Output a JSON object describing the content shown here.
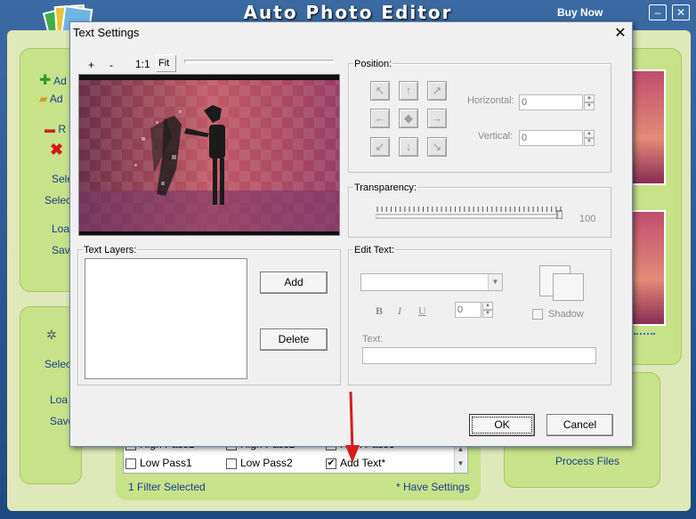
{
  "app": {
    "title": "Auto Photo Editor",
    "buy_now": "Buy Now",
    "minimize_glyph": "–",
    "close_glyph": "✕",
    "left_panel": {
      "items": [
        "Ad",
        "Ad",
        "R",
        "Sele",
        "Selec",
        "Loa",
        "Sav"
      ]
    },
    "left_panel2": {
      "items": [
        "Selec",
        "Loa",
        "Save"
      ]
    },
    "filters": {
      "row1": [
        "High Pass1",
        "High Pass2",
        "High Pass3"
      ],
      "row2": [
        "Low Pass1",
        "Low Pass2",
        "Add Text*"
      ],
      "row2_checked": [
        false,
        false,
        true
      ],
      "status_left": "1 Filter Selected",
      "status_right": "* Have Settings"
    },
    "process_files": "Process Files"
  },
  "dialog": {
    "title": "Text Settings",
    "close_glyph": "✕",
    "zoom_toolbar": {
      "plus": "+",
      "minus": "-",
      "one_to_one": "1:1",
      "fit": "Fit"
    },
    "position": {
      "label": "Position:",
      "arrows": [
        "↖",
        "↑",
        "↗",
        "←",
        "◆",
        "→",
        "↙",
        "↓",
        "↘"
      ],
      "horizontal_label": "Horizontal:",
      "horizontal_value": "0",
      "vertical_label": "Vertical:",
      "vertical_value": "0"
    },
    "transparency": {
      "label": "Transparency:",
      "value": "100",
      "level": 1.0
    },
    "text_layers": {
      "label": "Text Layers:",
      "add": "Add",
      "delete": "Delete"
    },
    "edit_text": {
      "label": "Edit Text:",
      "font_value": "",
      "bold": "B",
      "italic": "I",
      "underline": "U",
      "size_value": "0",
      "shadow_label": "Shadow",
      "text_label": "Text:",
      "text_value": ""
    },
    "ok": "OK",
    "cancel": "Cancel"
  },
  "colors": {
    "accent_panel": "#c8e28a",
    "app_blue": "#2a5587",
    "link": "#15408e",
    "arrow_red": "#d21e1e"
  }
}
